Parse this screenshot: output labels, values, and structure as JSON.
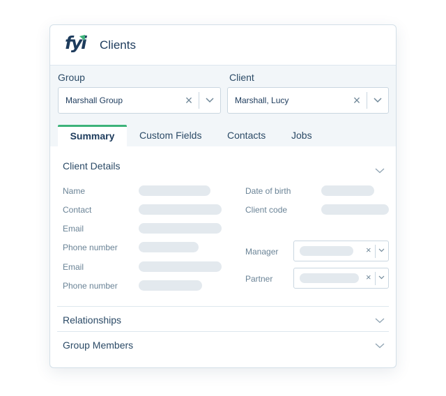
{
  "header": {
    "title": "Clients",
    "logo_text": "fyi"
  },
  "filters": {
    "group": {
      "label": "Group",
      "value": "Marshall Group"
    },
    "client": {
      "label": "Client",
      "value": "Marshall, Lucy"
    },
    "clear_glyph": "×",
    "mini_clear_glyph": "×"
  },
  "tabs": [
    {
      "label": "Summary",
      "active": true
    },
    {
      "label": "Custom Fields",
      "active": false
    },
    {
      "label": "Contacts",
      "active": false
    },
    {
      "label": "Jobs",
      "active": false
    }
  ],
  "client_details": {
    "title": "Client Details",
    "left_labels": [
      "Name",
      "Contact",
      "Email",
      "Phone number",
      "Email",
      "Phone number"
    ],
    "right_labels": [
      "Date of birth",
      "Client code",
      "Manager",
      "Partner"
    ]
  },
  "sections": {
    "relationships": "Relationships",
    "group_members": "Group Members"
  },
  "colors": {
    "accent": "#3db37a",
    "text": "#2b4a66",
    "placeholder": "#e3e9ee"
  }
}
